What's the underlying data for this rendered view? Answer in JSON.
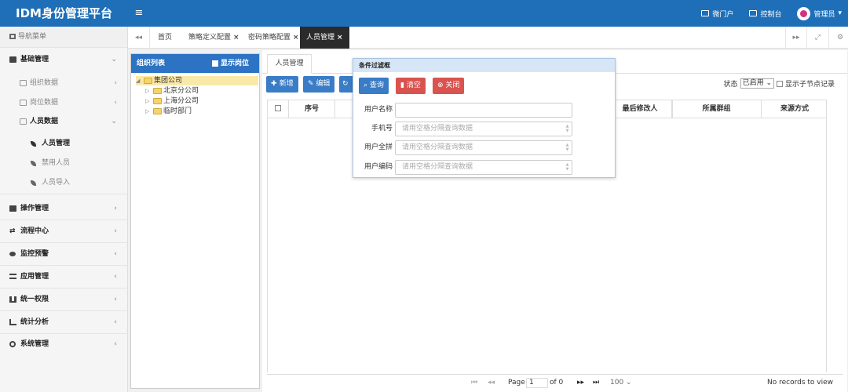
{
  "app": {
    "title": "IDM身份管理平台",
    "menu_icon": "≡"
  },
  "top_nav": {
    "portal": "微门户",
    "console": "控制台",
    "user": "管理员"
  },
  "sidebar": {
    "header": "导航菜单",
    "basic": "基础管理",
    "org_data": "组织数据",
    "post_data": "岗位数据",
    "person_data": "人员数据",
    "person_manage": "人员管理",
    "disabled_users": "禁用人员",
    "import_users": "人员导入",
    "ops": "操作管理",
    "flow": "流程中心",
    "monitor": "监控预警",
    "apps": "应用管理",
    "perm": "统一权限",
    "stats": "统计分析",
    "system": "系统管理"
  },
  "tabs": {
    "home": "首页",
    "policy": "策略定义配置",
    "pwd_policy": "密码策略配置",
    "users": "人员管理"
  },
  "org_panel": {
    "title": "组织列表",
    "show_post": "显示岗位",
    "root": "集团公司",
    "beijing": "北京分公司",
    "shanghai": "上海分公司",
    "temp": "临时部门"
  },
  "main": {
    "subtab": "人员管理",
    "add_btn": "新增",
    "edit_btn": "编辑",
    "status_label": "状态",
    "status_value": "已启用",
    "show_child": "显示子节点记录"
  },
  "grid": {
    "col_no": "序号",
    "col_modifier": "最后修改人",
    "col_group": "所属群组",
    "col_source": "来源方式"
  },
  "pager": {
    "page_label": "Page",
    "page_value": "1",
    "of_label": "of 0",
    "page_size": "100",
    "empty_text": "No records to view"
  },
  "filter": {
    "title": "条件过滤框",
    "search_btn": "查询",
    "clear_btn": "清空",
    "close_btn": "关闭",
    "username_label": "用户名称",
    "phone_label": "手机号",
    "pinyin_label": "用户全拼",
    "code_label": "用户编码",
    "placeholder": "请用空格分隔查询数据"
  }
}
